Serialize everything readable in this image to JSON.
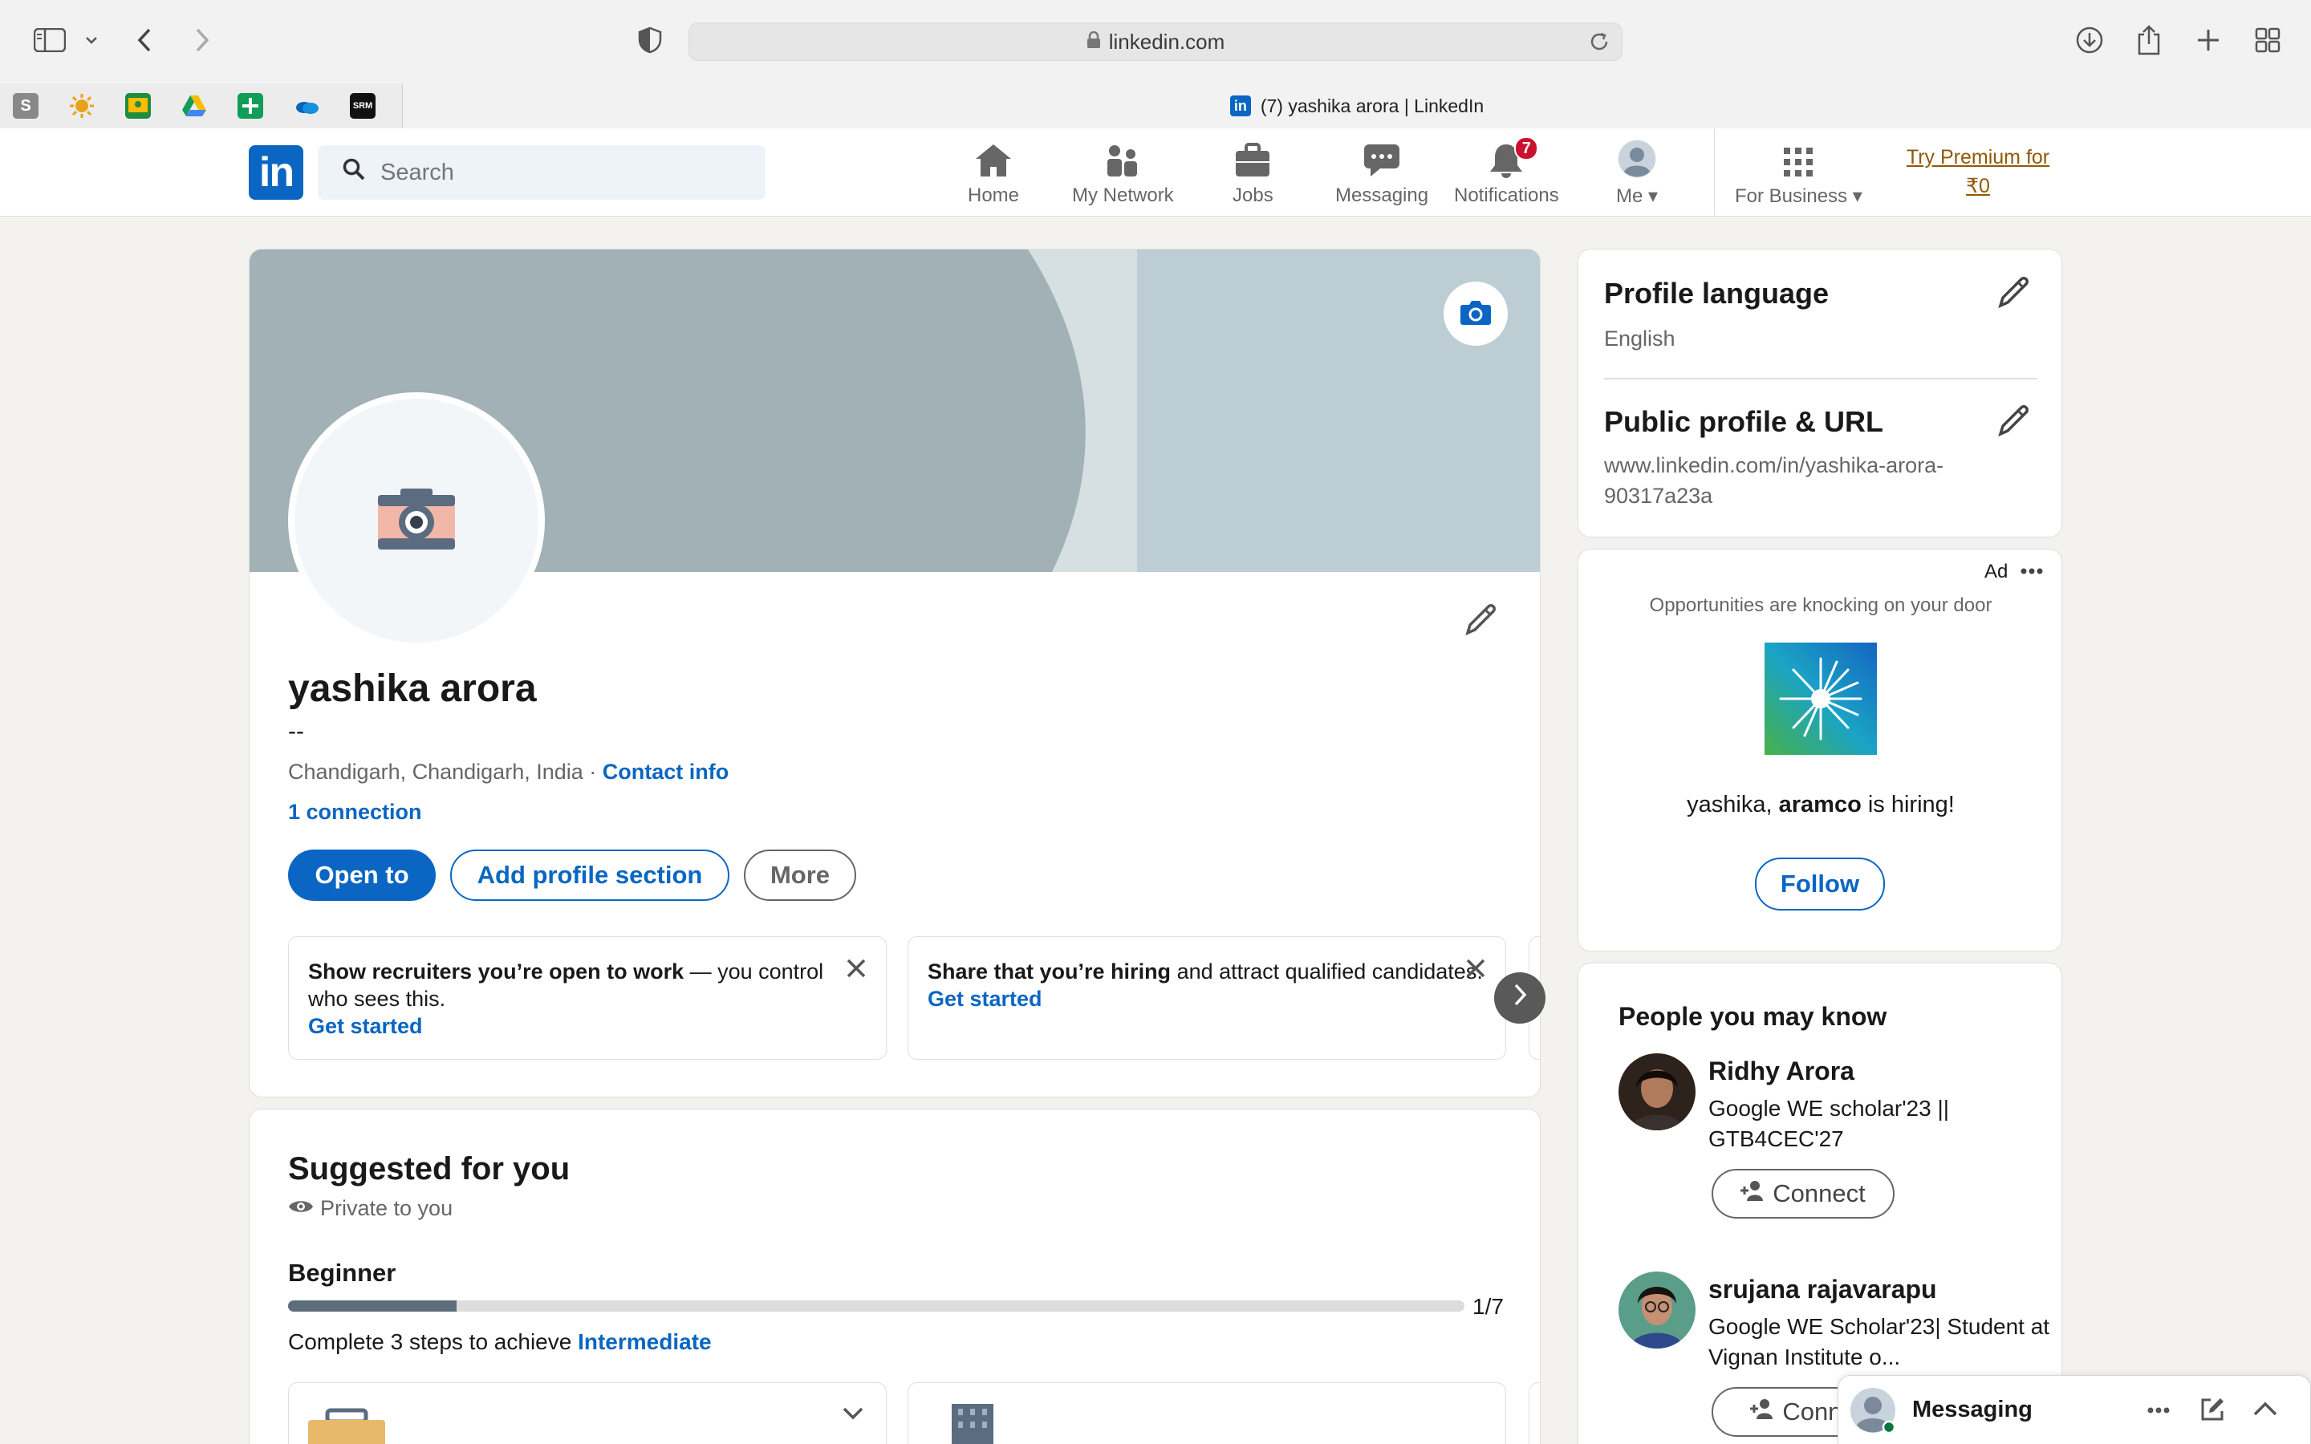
{
  "browser": {
    "url": "linkedin.com",
    "tab_title": "(7) yashika arora | LinkedIn",
    "favicons": [
      "S",
      "sun",
      "classroom",
      "drive",
      "sheets",
      "onedrive",
      "SRM"
    ]
  },
  "nav": {
    "search_placeholder": "Search",
    "items": [
      {
        "label": "Home",
        "icon": "home-icon"
      },
      {
        "label": "My Network",
        "icon": "network-icon"
      },
      {
        "label": "Jobs",
        "icon": "briefcase-icon"
      },
      {
        "label": "Messaging",
        "icon": "chat-icon"
      },
      {
        "label": "Notifications",
        "icon": "bell-icon",
        "badge": "7"
      },
      {
        "label": "Me",
        "icon": "avatar"
      },
      {
        "label": "For Business",
        "icon": "grid-icon"
      }
    ],
    "premium_line1": "Try Premium for",
    "premium_line2": "₹0"
  },
  "profile": {
    "name": "yashika arora",
    "headline": "--",
    "location": "Chandigarh, Chandigarh, India",
    "separator": " · ",
    "contact_info": "Contact info",
    "connections": "1 connection",
    "buttons": {
      "open_to": "Open to",
      "add_section": "Add profile section",
      "more": "More"
    },
    "cards": [
      {
        "bold": "Show recruiters you’re open to work",
        "rest": " — you control who sees this.",
        "cta": "Get started"
      },
      {
        "bold": "Share that you’re hiring",
        "rest": " and attract qualified candidates.",
        "cta": "Get started"
      }
    ]
  },
  "suggested": {
    "title": "Suggested for you",
    "privacy": "Private to you",
    "level": "Beginner",
    "progress_text": "1/7",
    "progress_fraction": 0.143,
    "steps_text": "Complete 3 steps to achieve ",
    "target_level": "Intermediate"
  },
  "sidebar": {
    "profile_language_title": "Profile language",
    "profile_language_value": "English",
    "public_profile_title": "Public profile & URL",
    "public_profile_url_line1": "www.linkedin.com/in/yashika-arora-",
    "public_profile_url_line2": "90317a23a"
  },
  "ad": {
    "label": "Ad",
    "tagline": "Opportunities are knocking on your door",
    "hiring_prefix": "yashika, ",
    "company": "aramco",
    "hiring_suffix": " is hiring!",
    "follow": "Follow"
  },
  "people": {
    "title": "People you may know",
    "list": [
      {
        "name": "Ridhy Arora",
        "desc": "Google WE scholar'23 || GTB4CEC'27",
        "button": "Connect"
      },
      {
        "name": "srujana rajavarapu",
        "desc": "Google WE Scholar'23| Student at Vignan Institute o...",
        "button": "Conne"
      }
    ]
  },
  "messaging": {
    "label": "Messaging"
  }
}
